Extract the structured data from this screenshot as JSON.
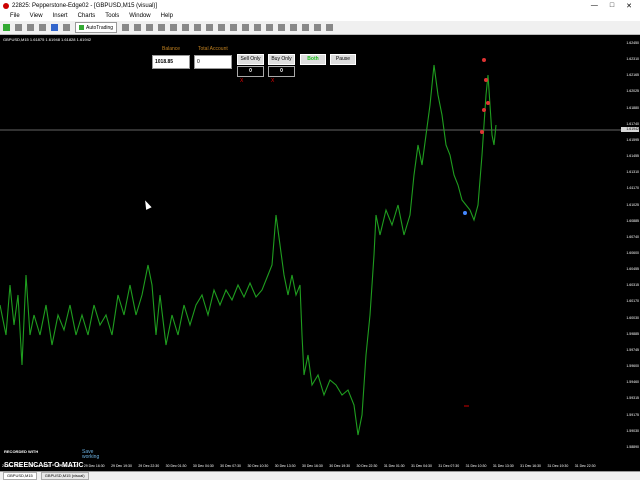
{
  "window": {
    "title": "22825: Pepperstone-Edge02 - [GBPUSD,M15 (visual)]",
    "controls": [
      "—",
      "□",
      "✕"
    ]
  },
  "menu": [
    "File",
    "View",
    "Insert",
    "Charts",
    "Tools",
    "Window",
    "Help"
  ],
  "toolbar": {
    "autotrading_label": "AutoTrading"
  },
  "chart": {
    "symbol_header": "GBPUSD,M15  1.61875  1.61948  1.61828  1.61942",
    "line_color": "#1f9d1f",
    "bid_line_color": "#c8c8c8",
    "current_price": "1.61942",
    "price_labels": [
      "1.62450",
      "1.62310",
      "1.62165",
      "1.62025",
      "1.61880",
      "1.61740",
      "1.61595",
      "1.61455",
      "1.61310",
      "1.61170",
      "1.61025",
      "1.60885",
      "1.60740",
      "1.60600",
      "1.60455",
      "1.60315",
      "1.60170",
      "1.60030",
      "1.59885",
      "1.59745",
      "1.59600",
      "1.59460",
      "1.59315",
      "1.59175",
      "1.59030",
      "1.58890"
    ],
    "time_labels": [
      "29 Dec 2014",
      "29 Dec 10:30",
      "29 Dec 13:30",
      "29 Dec 16:30",
      "29 Dec 19:30",
      "29 Dec 22:30",
      "30 Dec 01:30",
      "30 Dec 04:30",
      "30 Dec 07:30",
      "30 Dec 10:30",
      "30 Dec 13:30",
      "30 Dec 16:30",
      "30 Dec 19:30",
      "30 Dec 22:30",
      "31 Dec 01:30",
      "31 Dec 04:30",
      "31 Dec 07:30",
      "31 Dec 10:30",
      "31 Dec 13:30",
      "31 Dec 16:30",
      "31 Dec 19:30",
      "31 Dec 22:30"
    ]
  },
  "panel": {
    "balance_label": "Balance",
    "balance_value": "1018.85",
    "total_account_label": "Total Account",
    "total_account_value": "0",
    "sell_only": "Sell Only",
    "buy_only": "Buy Only",
    "both": "Both",
    "pause": "Pause",
    "sell_count": "0",
    "buy_count": "0",
    "close_mark": "X"
  },
  "tabs": [
    "GBPUSD,M15",
    "GBPUSD,M15 (visual)"
  ],
  "watermark": {
    "recorded_with": "RECORDED WITH",
    "brand": "SCREENCAST-O-MATIC",
    "working_label": "Save\nworking"
  }
}
